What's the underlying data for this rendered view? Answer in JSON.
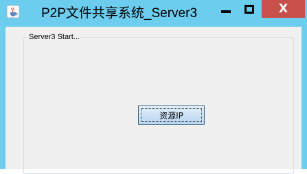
{
  "window": {
    "title": "P2P文件共享系统_Server3",
    "close_glyph": "X"
  },
  "icons": {
    "app": "java-cup-icon",
    "minimize": "minimize-icon",
    "maximize": "maximize-icon",
    "close": "close-icon"
  },
  "colors": {
    "titlebar": "#6ccdee",
    "close_button": "#c7504b",
    "panel": "#f0f0f0",
    "button_border": "#35668f"
  },
  "panel": {
    "group_label": "Server3 Start..."
  },
  "actions": {
    "resource_ip_label": "资源IP"
  }
}
